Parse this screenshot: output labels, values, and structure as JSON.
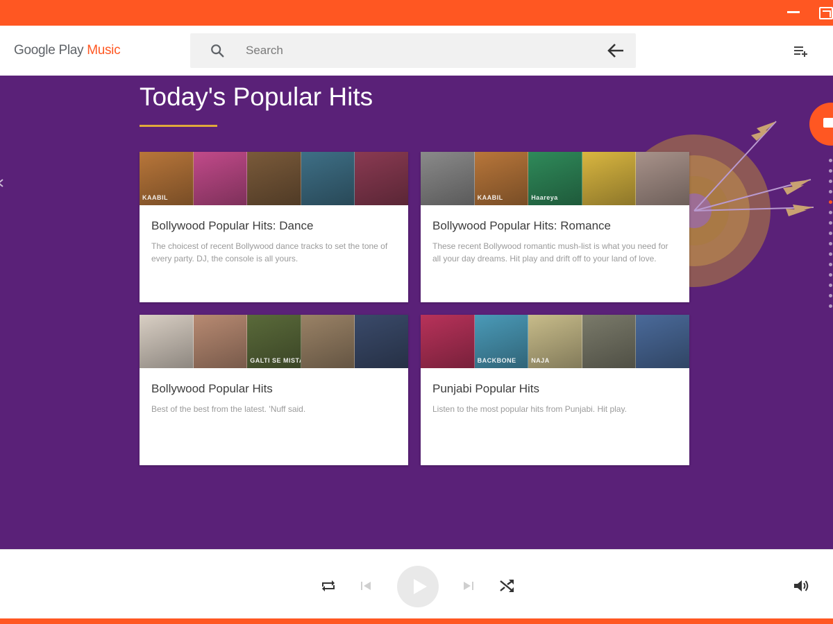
{
  "app": {
    "logo_prefix": "Google Play ",
    "logo_accent": "Music",
    "accent_color": "#ff5722",
    "main_bg_color": "#5a2178"
  },
  "header": {
    "search_placeholder": "Search",
    "icons": [
      "search-icon",
      "back-arrow-icon",
      "queue-icon"
    ]
  },
  "main": {
    "title": "Today's Popular Hits",
    "cards": [
      {
        "title": "Bollywood Popular Hits: Dance",
        "description": "The choicest of recent Bollywood dance tracks to set the tone of every party. DJ, the console is all yours.",
        "tiles": [
          {
            "text": "KAABIL",
            "color": "#b8763a"
          },
          {
            "text": "",
            "color": "#c14a8a"
          },
          {
            "text": "",
            "color": "#7a5a3a"
          },
          {
            "text": "",
            "color": "#3e6f86"
          },
          {
            "text": "",
            "color": "#8a3a52"
          }
        ]
      },
      {
        "title": "Bollywood Popular Hits: Romance",
        "description": "These recent Bollywood romantic mush-list is what you need for all your day dreams. Hit play and drift off to your land of love.",
        "tiles": [
          {
            "text": "",
            "color": "#8a8a8a"
          },
          {
            "text": "KAABIL",
            "color": "#b8763a"
          },
          {
            "text": "Haareya",
            "color": "#2f8a5a"
          },
          {
            "text": "",
            "color": "#d9b640"
          },
          {
            "text": "",
            "color": "#a8928a"
          }
        ]
      },
      {
        "title": "Bollywood Popular Hits",
        "description": "Best of the best from the latest. 'Nuff said.",
        "tiles": [
          {
            "text": "",
            "color": "#d9cfc4"
          },
          {
            "text": "",
            "color": "#b88a72"
          },
          {
            "text": "GALTI SE MISTAKE",
            "color": "#5a6a3a"
          },
          {
            "text": "",
            "color": "#9a8266"
          },
          {
            "text": "",
            "color": "#3a4a6a"
          }
        ]
      },
      {
        "title": "Punjabi Popular Hits",
        "description": "Listen to the most popular hits from Punjabi. Hit play.",
        "tiles": [
          {
            "text": "",
            "color": "#b8325a"
          },
          {
            "text": "BACKBONE",
            "color": "#4a9ab8"
          },
          {
            "text": "NAJA",
            "color": "#c8bc8a"
          },
          {
            "text": "",
            "color": "#7a7a6a"
          },
          {
            "text": "",
            "color": "#4a6a9a"
          }
        ]
      }
    ]
  },
  "player": {
    "icons": [
      "repeat-icon",
      "previous-icon",
      "play-icon",
      "next-icon",
      "shuffle-icon",
      "volume-icon"
    ]
  }
}
